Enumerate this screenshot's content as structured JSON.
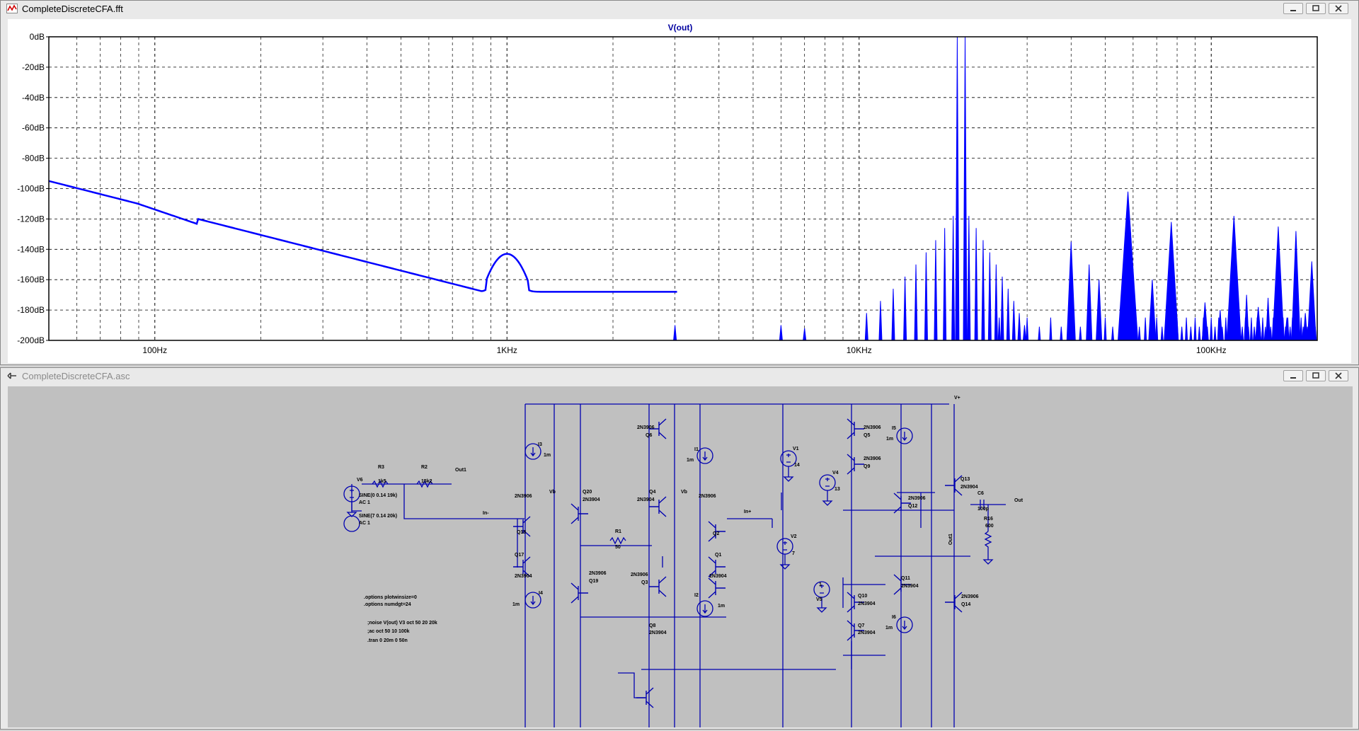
{
  "plot_window": {
    "title": "CompleteDiscreteCFA.fft",
    "trace_name": "V(out)",
    "x_ticks": [
      "100Hz",
      "1KHz",
      "10KHz",
      "100KHz"
    ],
    "y_ticks": [
      "0dB",
      "-20dB",
      "-40dB",
      "-60dB",
      "-80dB",
      "-100dB",
      "-120dB",
      "-140dB",
      "-160dB",
      "-180dB",
      "-200dB"
    ]
  },
  "schematic_window": {
    "title": "CompleteDiscreteCFA.asc",
    "components": {
      "V6": "V6",
      "R3": "R3",
      "R3_val": "1k5",
      "R2": "R2",
      "R2_val": "15k2",
      "Out1_a": "Out1",
      "V6_src1": "SINE(0 0.14 19k)",
      "V6_ac1": "AC 1",
      "V6_src2": "SINE(7 0.14 20k)",
      "V6_ac2": "AC 1",
      "I3": "I3",
      "I3_val": "1m",
      "Q18": "Q18",
      "Q18_model": "2N3906",
      "Q17": "Q17",
      "Q17_model": "2N3904",
      "Q20": "Q20",
      "Q20_model": "2N3904",
      "Q19": "Q19",
      "Q19_model": "2N3906",
      "I4": "I4",
      "I4_val": "1m",
      "Vb_a": "Vb",
      "In_minus": "In-",
      "R1": "R1",
      "R1_val": "50",
      "Q6": "Q6",
      "Q6_model": "2N3906",
      "Q4": "Q4",
      "Q4_model": "2N3904",
      "Q3": "Q3",
      "Q3_model": "2N3906",
      "Q8": "Q8",
      "Q8_model": "2N3904",
      "I1": "I1",
      "I1_val": "1m",
      "Vb_b": "Vb",
      "Q2": "Q2",
      "Q2_model": "2N3906",
      "Q1": "Q1",
      "Q1_model": "2N3904",
      "I2": "I2",
      "I2_val": "1m",
      "In_plus": "In+",
      "V1": "V1",
      "V1_val": "14",
      "V2": "V2",
      "V2_val": "7",
      "Q5": "Q5",
      "Q5_model": "2N3906",
      "Q9": "Q9",
      "Q9_model": "2N3906",
      "V4": "V4",
      "V4_val": "13",
      "I5": "I5",
      "I5_val": "1m",
      "Q13": "Q13",
      "Q13_model": "2N3904",
      "Q12": "Q12",
      "Q12_model": "2N3906",
      "C6": "C6",
      "C6_val": "100p",
      "Out": "Out",
      "R16": "R16",
      "R16_val": "600",
      "Out1_b": "Out1",
      "Vplus": "V+",
      "Q11": "Q11",
      "Q11_model": "2N3904",
      "Q10": "Q10",
      "Q10_model": "2N3904",
      "V5": "V5",
      "V5_val": "1",
      "Q7": "Q7",
      "Q7_model": "2N3904",
      "I6": "I6",
      "I6_val": "1m",
      "Q14": "Q14",
      "Q14_model": "2N3906"
    },
    "directives": [
      ".options plotwinsize=0",
      ".options numdgt=24",
      ";noise V(out) V3 oct 50 20 20k",
      ";ac oct 50 10 100k",
      ".tran 0 20m 0 50n"
    ]
  },
  "colors": {
    "trace": "#0000ff",
    "wire": "#0000b0",
    "schematic_bg": "#c0c0c0",
    "grid": "#000000",
    "axis_text": "#0000a0"
  },
  "icons": {
    "plot_icon": "waveform-icon",
    "schematic_icon": "schematic-icon"
  }
}
